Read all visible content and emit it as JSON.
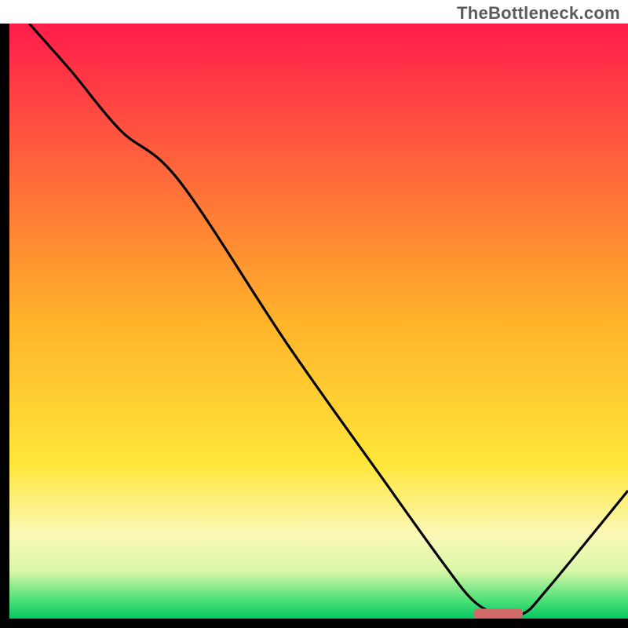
{
  "attribution": "TheBottleneck.com",
  "chart_data": {
    "type": "line",
    "title": "",
    "xlabel": "",
    "ylabel": "",
    "xlim": [
      0,
      100
    ],
    "ylim": [
      0,
      100
    ],
    "gradient_stops": [
      {
        "offset": 0.0,
        "color": "#ff1c4b"
      },
      {
        "offset": 0.5,
        "color": "#ffb32a"
      },
      {
        "offset": 0.74,
        "color": "#ffe63a"
      },
      {
        "offset": 0.86,
        "color": "#fbf8b8"
      },
      {
        "offset": 0.92,
        "color": "#d9f7a8"
      },
      {
        "offset": 0.97,
        "color": "#4ae077"
      },
      {
        "offset": 1.0,
        "color": "#07c862"
      }
    ],
    "series": [
      {
        "name": "bottleneck-curve",
        "color": "#000000",
        "x": [
          3.2,
          10.0,
          18.0,
          27.5,
          45.0,
          60.0,
          70.0,
          75.0,
          79.0,
          83.0,
          87.0,
          100.0
        ],
        "y": [
          100.0,
          92.0,
          82.0,
          73.5,
          46.0,
          24.0,
          9.5,
          3.0,
          0.8,
          0.8,
          5.0,
          21.5
        ]
      }
    ],
    "marker": {
      "x_start": 75.0,
      "x_end": 83.0,
      "y": 0.8,
      "color": "#d36a6a"
    },
    "axes": {
      "color": "#000000",
      "thickness_px": 12
    }
  }
}
